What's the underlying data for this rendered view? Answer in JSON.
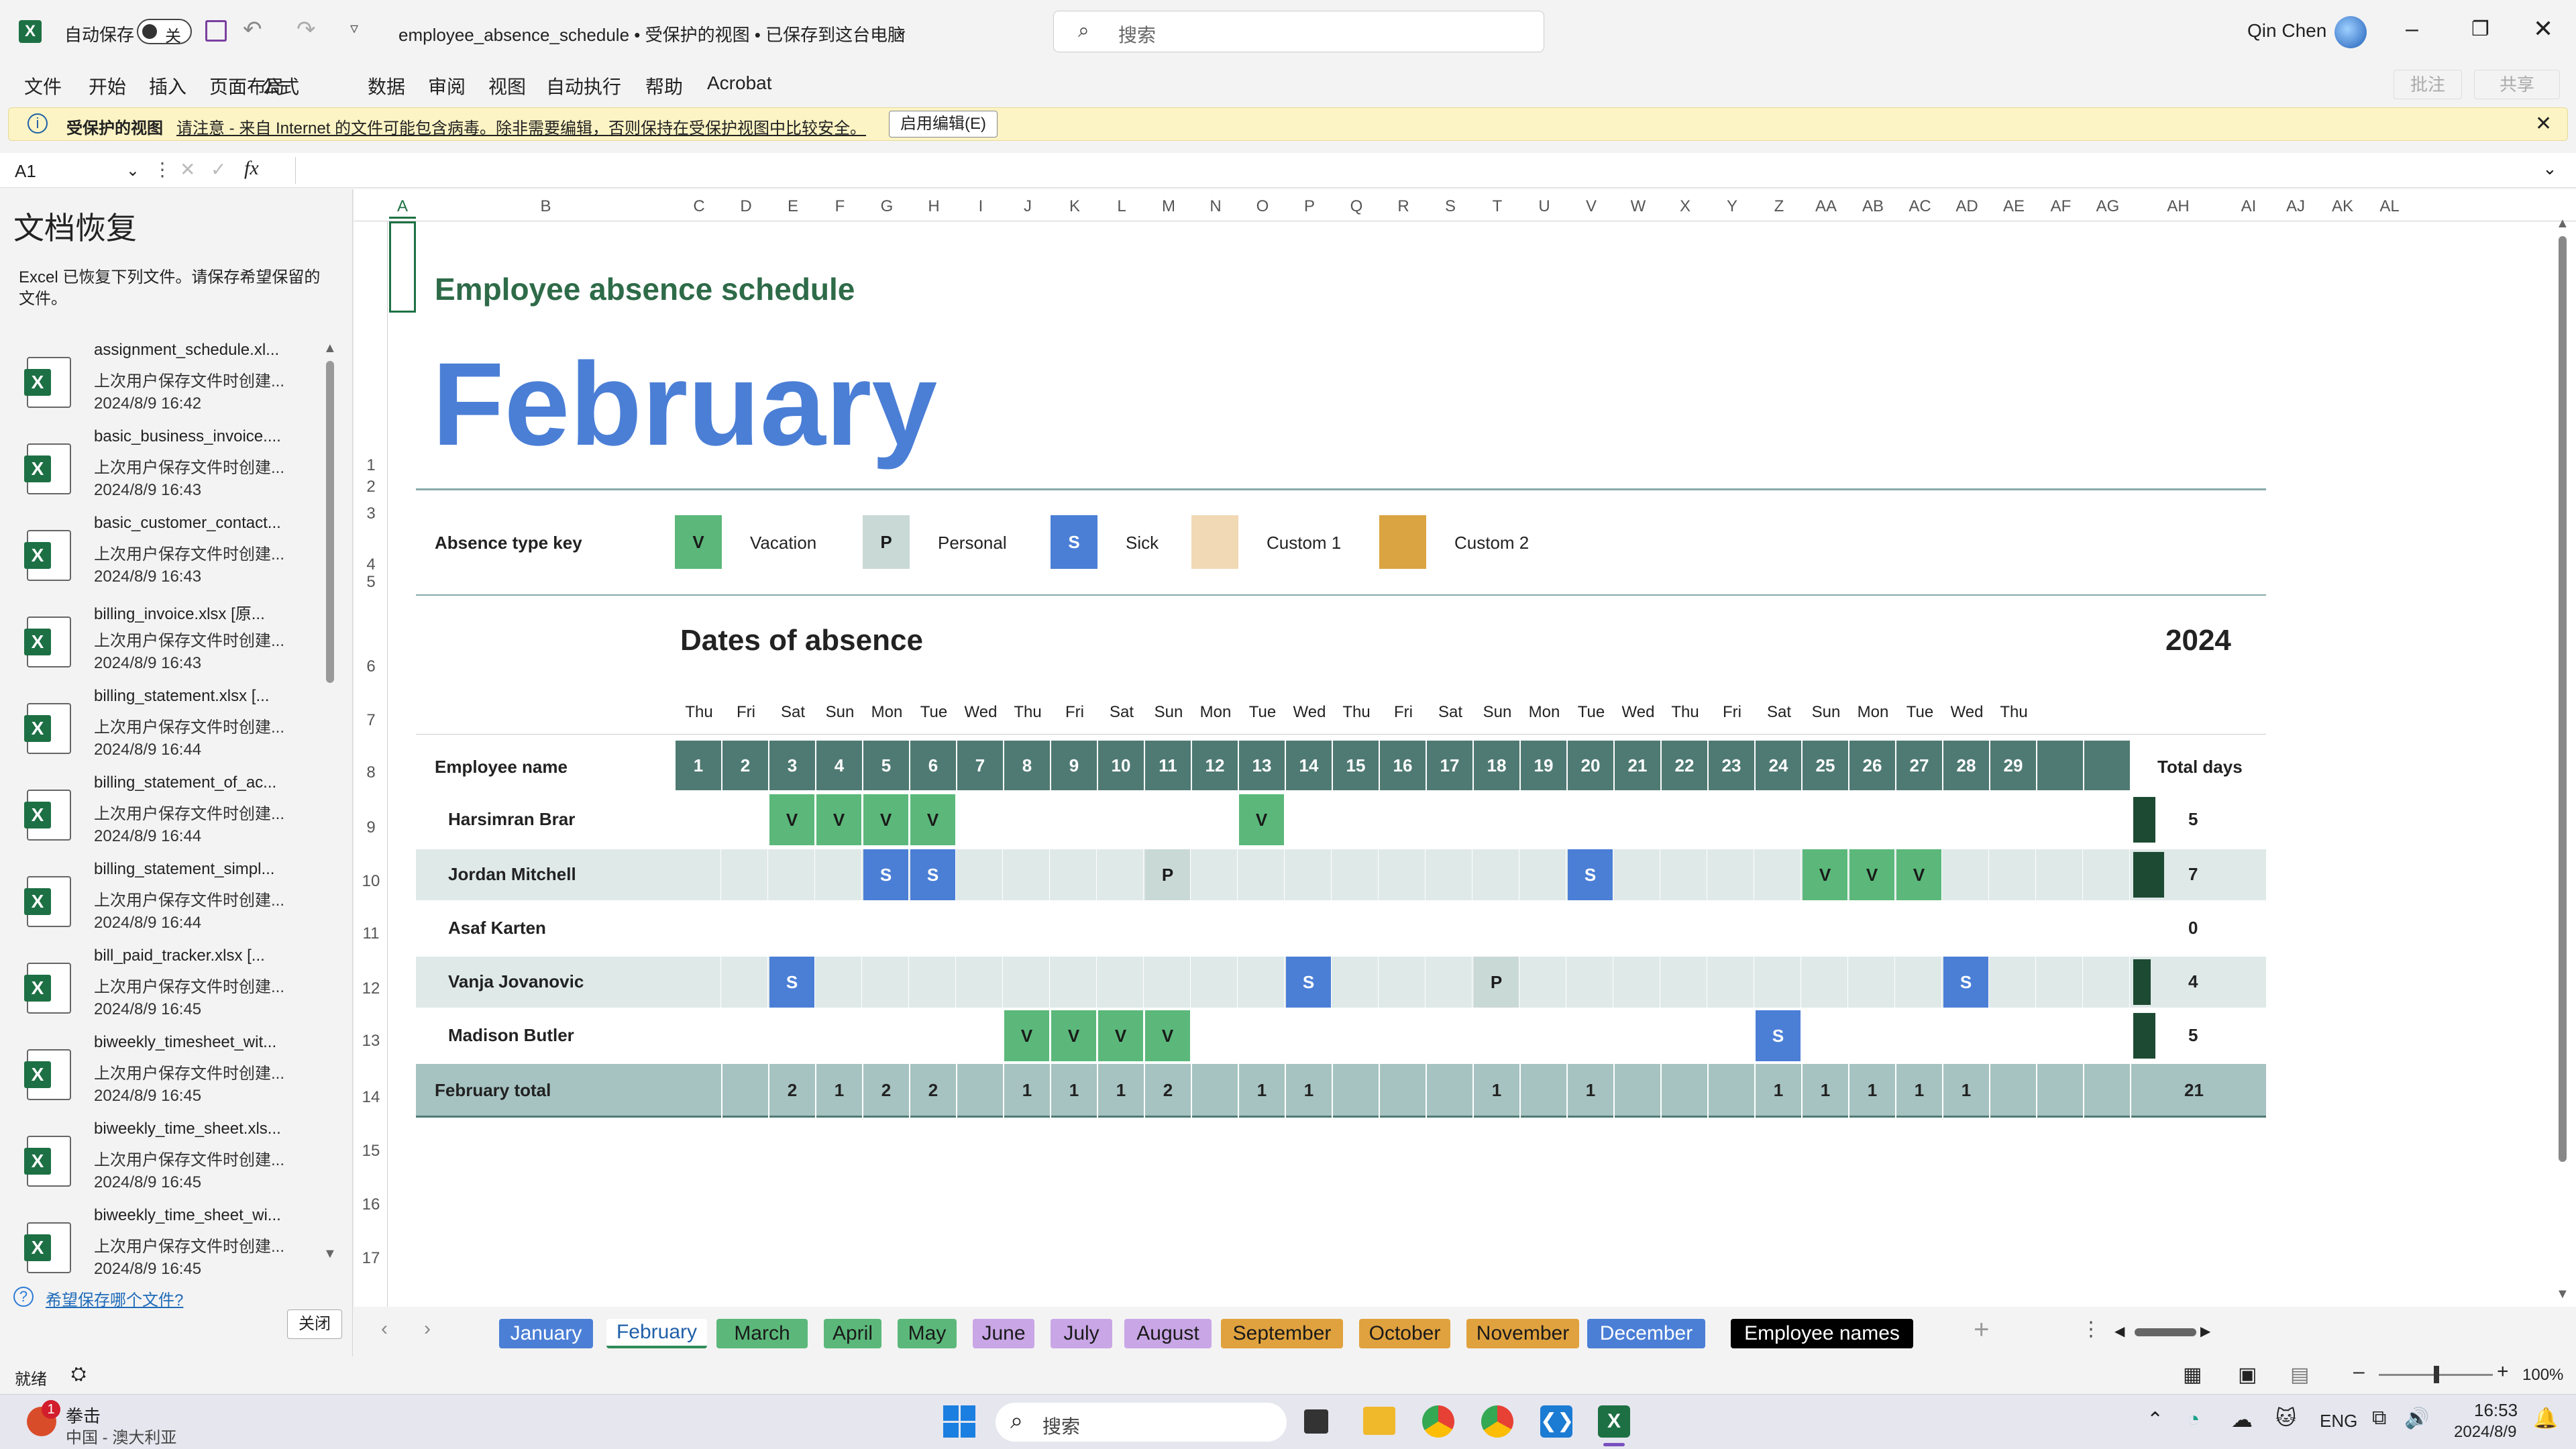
{
  "titlebar": {
    "autosave_label": "自动保存",
    "autosave_state": "关",
    "doc_title": "employee_absence_schedule  •  受保护的视图 • 已保存到这台电脑",
    "search_placeholder": "搜索",
    "user_name": "Qin Chen"
  },
  "menu": [
    "文件",
    "开始",
    "插入",
    "页面布局",
    "公式",
    "数据",
    "审阅",
    "视图",
    "自动执行",
    "帮助",
    "Acrobat"
  ],
  "menu_right": {
    "comments": "批注",
    "share": "共享"
  },
  "protected_view": {
    "title": "受保护的视图",
    "message": "请注意 - 来自 Internet 的文件可能包含病毒。除非需要编辑，否则保持在受保护视图中比较安全。",
    "button": "启用编辑(E)"
  },
  "formula_bar": {
    "name_box": "A1",
    "fx": "fx",
    "value": ""
  },
  "recovery": {
    "title": "文档恢复",
    "description": "Excel 已恢复下列文件。请保存希望保留的文件。",
    "items": [
      {
        "name": "assignment_schedule.xl...",
        "desc": "上次用户保存文件时创建...",
        "time": "2024/8/9 16:42"
      },
      {
        "name": "basic_business_invoice....",
        "desc": "上次用户保存文件时创建...",
        "time": "2024/8/9 16:43"
      },
      {
        "name": "basic_customer_contact...",
        "desc": "上次用户保存文件时创建...",
        "time": "2024/8/9 16:43"
      },
      {
        "name": "billing_invoice.xlsx  [原...",
        "desc": "上次用户保存文件时创建...",
        "time": "2024/8/9 16:43"
      },
      {
        "name": "billing_statement.xlsx  [...",
        "desc": "上次用户保存文件时创建...",
        "time": "2024/8/9 16:44"
      },
      {
        "name": "billing_statement_of_ac...",
        "desc": "上次用户保存文件时创建...",
        "time": "2024/8/9 16:44"
      },
      {
        "name": "billing_statement_simpl...",
        "desc": "上次用户保存文件时创建...",
        "time": "2024/8/9 16:44"
      },
      {
        "name": "bill_paid_tracker.xlsx  [...",
        "desc": "上次用户保存文件时创建...",
        "time": "2024/8/9 16:45"
      },
      {
        "name": "biweekly_timesheet_wit...",
        "desc": "上次用户保存文件时创建...",
        "time": "2024/8/9 16:45"
      },
      {
        "name": "biweekly_time_sheet.xls...",
        "desc": "上次用户保存文件时创建...",
        "time": "2024/8/9 16:45"
      },
      {
        "name": "biweekly_time_sheet_wi...",
        "desc": "上次用户保存文件时创建...",
        "time": "2024/8/9 16:45"
      }
    ],
    "help_link": "希望保存哪个文件?",
    "close_button": "关闭"
  },
  "columns": [
    "A",
    "B",
    "C",
    "D",
    "E",
    "F",
    "G",
    "H",
    "I",
    "J",
    "K",
    "L",
    "M",
    "N",
    "O",
    "P",
    "Q",
    "R",
    "S",
    "T",
    "U",
    "V",
    "W",
    "X",
    "Y",
    "Z",
    "AA",
    "AB",
    "AC",
    "AD",
    "AE",
    "AF",
    "AG",
    "AH",
    "AI",
    "AJ",
    "AK",
    "AL"
  ],
  "rows": [
    "1",
    "2",
    "3",
    "4",
    "5",
    "6",
    "7",
    "8",
    "9",
    "10",
    "11",
    "12",
    "13",
    "14",
    "15",
    "16",
    "17"
  ],
  "schedule": {
    "title": "Employee absence schedule",
    "month": "February",
    "key_label": "Absence type key",
    "key": [
      {
        "code": "V",
        "label": "Vacation",
        "color": "#5bb87a"
      },
      {
        "code": "P",
        "label": "Personal",
        "color": "#c9d9d6"
      },
      {
        "code": "S",
        "label": "Sick",
        "color": "#4b7fd6"
      },
      {
        "code": "",
        "label": "Custom 1",
        "color": "#f1d9b5"
      },
      {
        "code": "",
        "label": "Custom 2",
        "color": "#d9a441"
      }
    ],
    "dates_label": "Dates of absence",
    "year": "2024",
    "weekdays": [
      "Thu",
      "Fri",
      "Sat",
      "Sun",
      "Mon",
      "Tue",
      "Wed",
      "Thu",
      "Fri",
      "Sat",
      "Sun",
      "Mon",
      "Tue",
      "Wed",
      "Thu",
      "Fri",
      "Sat",
      "Sun",
      "Mon",
      "Tue",
      "Wed",
      "Thu",
      "Fri",
      "Sat",
      "Sun",
      "Mon",
      "Tue",
      "Wed",
      "Thu"
    ],
    "days": [
      "1",
      "2",
      "3",
      "4",
      "5",
      "6",
      "7",
      "8",
      "9",
      "10",
      "11",
      "12",
      "13",
      "14",
      "15",
      "16",
      "17",
      "18",
      "19",
      "20",
      "21",
      "22",
      "23",
      "24",
      "25",
      "26",
      "27",
      "28",
      "29",
      "",
      ""
    ],
    "employee_header": "Employee name",
    "total_header": "Total days",
    "employees": [
      {
        "name": "Harsimran Brar",
        "total": "5",
        "absences": {
          "3": "V",
          "4": "V",
          "5": "V",
          "6": "V",
          "13": "V"
        }
      },
      {
        "name": "Jordan Mitchell",
        "total": "7",
        "absences": {
          "5": "S",
          "6": "S",
          "11": "P",
          "20": "S",
          "25": "V",
          "26": "V",
          "27": "V"
        }
      },
      {
        "name": "Asaf Karten",
        "total": "0",
        "absences": {}
      },
      {
        "name": "Vanja Jovanovic",
        "total": "4",
        "absences": {
          "3": "S",
          "14": "S",
          "18": "P",
          "28": "S"
        }
      },
      {
        "name": "Madison Butler",
        "total": "5",
        "absences": {
          "8": "V",
          "9": "V",
          "10": "V",
          "11": "V",
          "24": "S"
        }
      }
    ],
    "total_label": "February total",
    "day_totals": [
      "",
      "",
      "2",
      "1",
      "2",
      "2",
      "",
      "1",
      "1",
      "1",
      "2",
      "",
      "1",
      "1",
      "",
      "",
      "",
      "1",
      "",
      "1",
      "",
      "",
      "",
      "1",
      "1",
      "1",
      "1",
      "1",
      "",
      "",
      ""
    ],
    "grand_total": "21"
  },
  "sheet_tabs": [
    {
      "label": "January",
      "bg": "#4b7fd6",
      "fg": "#ffffff"
    },
    {
      "label": "February",
      "bg": "#ffffff",
      "fg": "#1f5fa8",
      "active": true
    },
    {
      "label": "March",
      "bg": "#5bb87a",
      "fg": "#1a1a1a"
    },
    {
      "label": "April",
      "bg": "#5bb87a",
      "fg": "#1a1a1a"
    },
    {
      "label": "May",
      "bg": "#5bb87a",
      "fg": "#1a1a1a"
    },
    {
      "label": "June",
      "bg": "#c9a6e6",
      "fg": "#1a1a1a"
    },
    {
      "label": "July",
      "bg": "#c9a6e6",
      "fg": "#1a1a1a"
    },
    {
      "label": "August",
      "bg": "#c9a6e6",
      "fg": "#1a1a1a"
    },
    {
      "label": "September",
      "bg": "#e0a23e",
      "fg": "#1a1a1a"
    },
    {
      "label": "October",
      "bg": "#e0a23e",
      "fg": "#1a1a1a"
    },
    {
      "label": "November",
      "bg": "#e0a23e",
      "fg": "#1a1a1a"
    },
    {
      "label": "December",
      "bg": "#4b7fd6",
      "fg": "#ffffff"
    },
    {
      "label": "Employee names",
      "bg": "#000000",
      "fg": "#ffffff"
    }
  ],
  "status": {
    "ready": "就绪",
    "zoom": "100%"
  },
  "taskbar": {
    "weather_title": "拳击",
    "weather_sub": "中国 - 澳大利亚",
    "badge": "1",
    "search": "搜索",
    "lang": "ENG",
    "time": "16:53",
    "date": "2024/8/9"
  },
  "colors": {
    "header_dark": "#4f7a73",
    "total_bg": "#a6c3c1",
    "alt_row": "#dfe9e8",
    "title_green": "#2e6b48",
    "month_blue": "#4b7fd6"
  }
}
